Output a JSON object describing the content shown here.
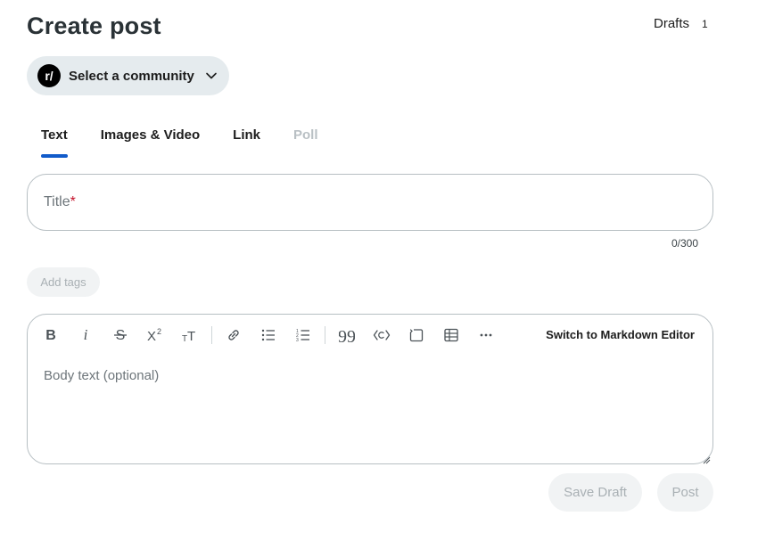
{
  "page": {
    "title": "Create post"
  },
  "drafts": {
    "label": "Drafts",
    "count": "1"
  },
  "community_select": {
    "label": "Select a community",
    "logo_text": "r/"
  },
  "tabs": [
    {
      "label": "Text",
      "active": true,
      "disabled": false
    },
    {
      "label": "Images & Video",
      "active": false,
      "disabled": false
    },
    {
      "label": "Link",
      "active": false,
      "disabled": false
    },
    {
      "label": "Poll",
      "active": false,
      "disabled": true
    }
  ],
  "title_field": {
    "placeholder": "Title",
    "required_mark": "*",
    "char_count": "0/300"
  },
  "tags": {
    "add_label": "Add tags"
  },
  "editor": {
    "placeholder": "Body text (optional)",
    "switch_label": "Switch to Markdown Editor",
    "toolbar_icons": [
      "bold-icon",
      "italic-icon",
      "strikethrough-icon",
      "superscript-icon",
      "heading-icon",
      "link-icon",
      "bullet-list-icon",
      "numbered-list-icon",
      "quote-icon",
      "code-icon",
      "code-block-icon",
      "table-icon",
      "more-icon"
    ]
  },
  "actions": {
    "save_draft": "Save Draft",
    "post": "Post"
  },
  "colors": {
    "accent": "#115bca",
    "required": "#c3112a",
    "chip_bg": "#e5ebee",
    "disabled_bg": "#f1f3f4",
    "disabled_text": "#a9b0b4"
  }
}
